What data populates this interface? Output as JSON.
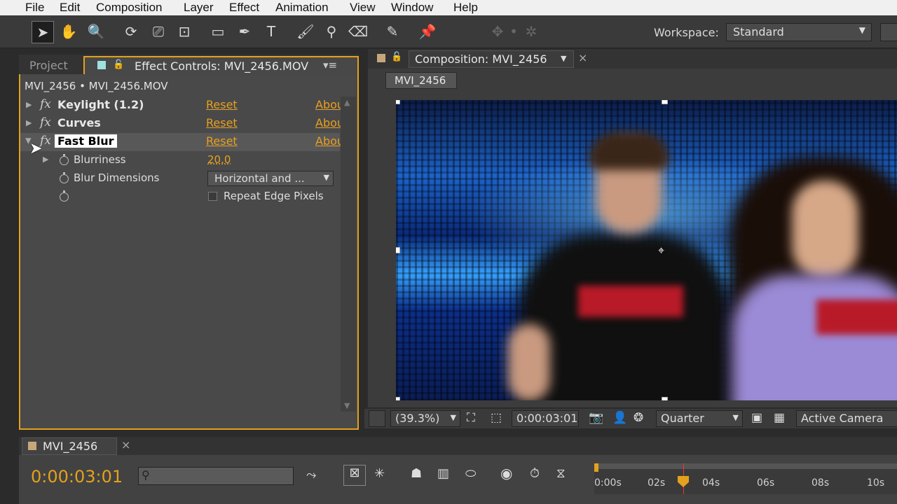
{
  "menu": [
    "File",
    "Edit",
    "Composition",
    "Layer",
    "Effect",
    "Animation",
    "View",
    "Window",
    "Help"
  ],
  "workspace": {
    "label": "Workspace:",
    "value": "Standard"
  },
  "left_panel": {
    "tab_project": "Project",
    "tab_effect_controls": "Effect Controls: MVI_2456.MOV",
    "breadcrumb": "MVI_2456 • MVI_2456.MOV",
    "effects": [
      {
        "name": "Keylight (1.2)",
        "reset": "Reset",
        "about": "About..."
      },
      {
        "name": "Curves",
        "reset": "Reset",
        "about": "About..."
      },
      {
        "name": "Fast Blur",
        "reset": "Reset",
        "about": "About..."
      }
    ],
    "params": {
      "blurriness_label": "Blurriness",
      "blurriness_value": "20.0",
      "blur_dimensions_label": "Blur Dimensions",
      "blur_dimensions_value": "Horizontal and ...",
      "repeat_edge_label": "Repeat Edge Pixels"
    }
  },
  "comp_panel": {
    "tab": "Composition: MVI_2456",
    "subtab": "MVI_2456",
    "zoom": "(39.3%)",
    "timecode": "0:00:03:01",
    "resolution": "Quarter",
    "camera": "Active Camera"
  },
  "timeline": {
    "tab": "MVI_2456",
    "timecode": "0:00:03:01",
    "ticks": [
      "0:00s",
      "02s",
      "04s",
      "06s",
      "08s",
      "10s"
    ]
  },
  "colors": {
    "accent": "#e3a11d",
    "link": "#e8a020"
  }
}
